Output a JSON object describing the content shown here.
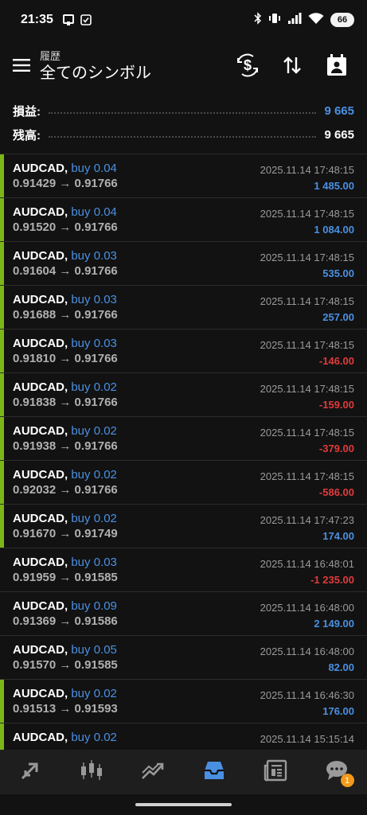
{
  "status_bar": {
    "time": "21:35",
    "battery": "66",
    "icons": [
      "notification-icon",
      "checkbox-icon",
      "bluetooth-icon",
      "vibrate-icon",
      "signal-icon",
      "wifi-icon"
    ]
  },
  "header": {
    "subtitle": "履歴",
    "title": "全てのシンボル",
    "icons": [
      "menu-icon",
      "currency-exchange-icon",
      "sort-icon",
      "calendar-icon"
    ]
  },
  "summary": {
    "profit_label": "損益:",
    "profit_value": "9 665",
    "balance_label": "残高:",
    "balance_value": "9 665"
  },
  "trades": [
    {
      "symbol": "AUDCAD,",
      "type": "buy 0.04",
      "prices": "0.91429 → 0.91766",
      "date": "2025.11.14 17:48:15",
      "profit": "1 485.00",
      "positive": true,
      "marked": true
    },
    {
      "symbol": "AUDCAD,",
      "type": "buy 0.04",
      "prices": "0.91520 → 0.91766",
      "date": "2025.11.14 17:48:15",
      "profit": "1 084.00",
      "positive": true,
      "marked": true
    },
    {
      "symbol": "AUDCAD,",
      "type": "buy 0.03",
      "prices": "0.91604 → 0.91766",
      "date": "2025.11.14 17:48:15",
      "profit": "535.00",
      "positive": true,
      "marked": true
    },
    {
      "symbol": "AUDCAD,",
      "type": "buy 0.03",
      "prices": "0.91688 → 0.91766",
      "date": "2025.11.14 17:48:15",
      "profit": "257.00",
      "positive": true,
      "marked": true
    },
    {
      "symbol": "AUDCAD,",
      "type": "buy 0.03",
      "prices": "0.91810 → 0.91766",
      "date": "2025.11.14 17:48:15",
      "profit": "-146.00",
      "positive": false,
      "marked": true
    },
    {
      "symbol": "AUDCAD,",
      "type": "buy 0.02",
      "prices": "0.91838 → 0.91766",
      "date": "2025.11.14 17:48:15",
      "profit": "-159.00",
      "positive": false,
      "marked": true
    },
    {
      "symbol": "AUDCAD,",
      "type": "buy 0.02",
      "prices": "0.91938 → 0.91766",
      "date": "2025.11.14 17:48:15",
      "profit": "-379.00",
      "positive": false,
      "marked": true
    },
    {
      "symbol": "AUDCAD,",
      "type": "buy 0.02",
      "prices": "0.92032 → 0.91766",
      "date": "2025.11.14 17:48:15",
      "profit": "-586.00",
      "positive": false,
      "marked": true
    },
    {
      "symbol": "AUDCAD,",
      "type": "buy 0.02",
      "prices": "0.91670 → 0.91749",
      "date": "2025.11.14 17:47:23",
      "profit": "174.00",
      "positive": true,
      "marked": true
    },
    {
      "symbol": "AUDCAD,",
      "type": "buy 0.03",
      "prices": "0.91959 → 0.91585",
      "date": "2025.11.14 16:48:01",
      "profit": "-1 235.00",
      "positive": false,
      "marked": false
    },
    {
      "symbol": "AUDCAD,",
      "type": "buy 0.09",
      "prices": "0.91369 → 0.91586",
      "date": "2025.11.14 16:48:00",
      "profit": "2 149.00",
      "positive": true,
      "marked": false
    },
    {
      "symbol": "AUDCAD,",
      "type": "buy 0.05",
      "prices": "0.91570 → 0.91585",
      "date": "2025.11.14 16:48:00",
      "profit": "82.00",
      "positive": true,
      "marked": false
    },
    {
      "symbol": "AUDCAD,",
      "type": "buy 0.02",
      "prices": "0.91513 → 0.91593",
      "date": "2025.11.14 16:46:30",
      "profit": "176.00",
      "positive": true,
      "marked": true
    },
    {
      "symbol": "AUDCAD,",
      "type": "buy 0.02",
      "prices": "",
      "date": "2025.11.14 15:15:14",
      "profit": "",
      "positive": true,
      "marked": true
    }
  ],
  "bottom_nav": {
    "items": [
      "quotes-icon",
      "chart-icon",
      "trade-icon",
      "history-icon",
      "news-icon",
      "chat-icon"
    ],
    "active": "history-icon",
    "chat_badge": "1"
  },
  "colors": {
    "background": "#121212",
    "accent_blue": "#4a90e2",
    "loss_red": "#e23a3a",
    "marker_green": "#7cb518",
    "badge_orange": "#f29a1b"
  }
}
